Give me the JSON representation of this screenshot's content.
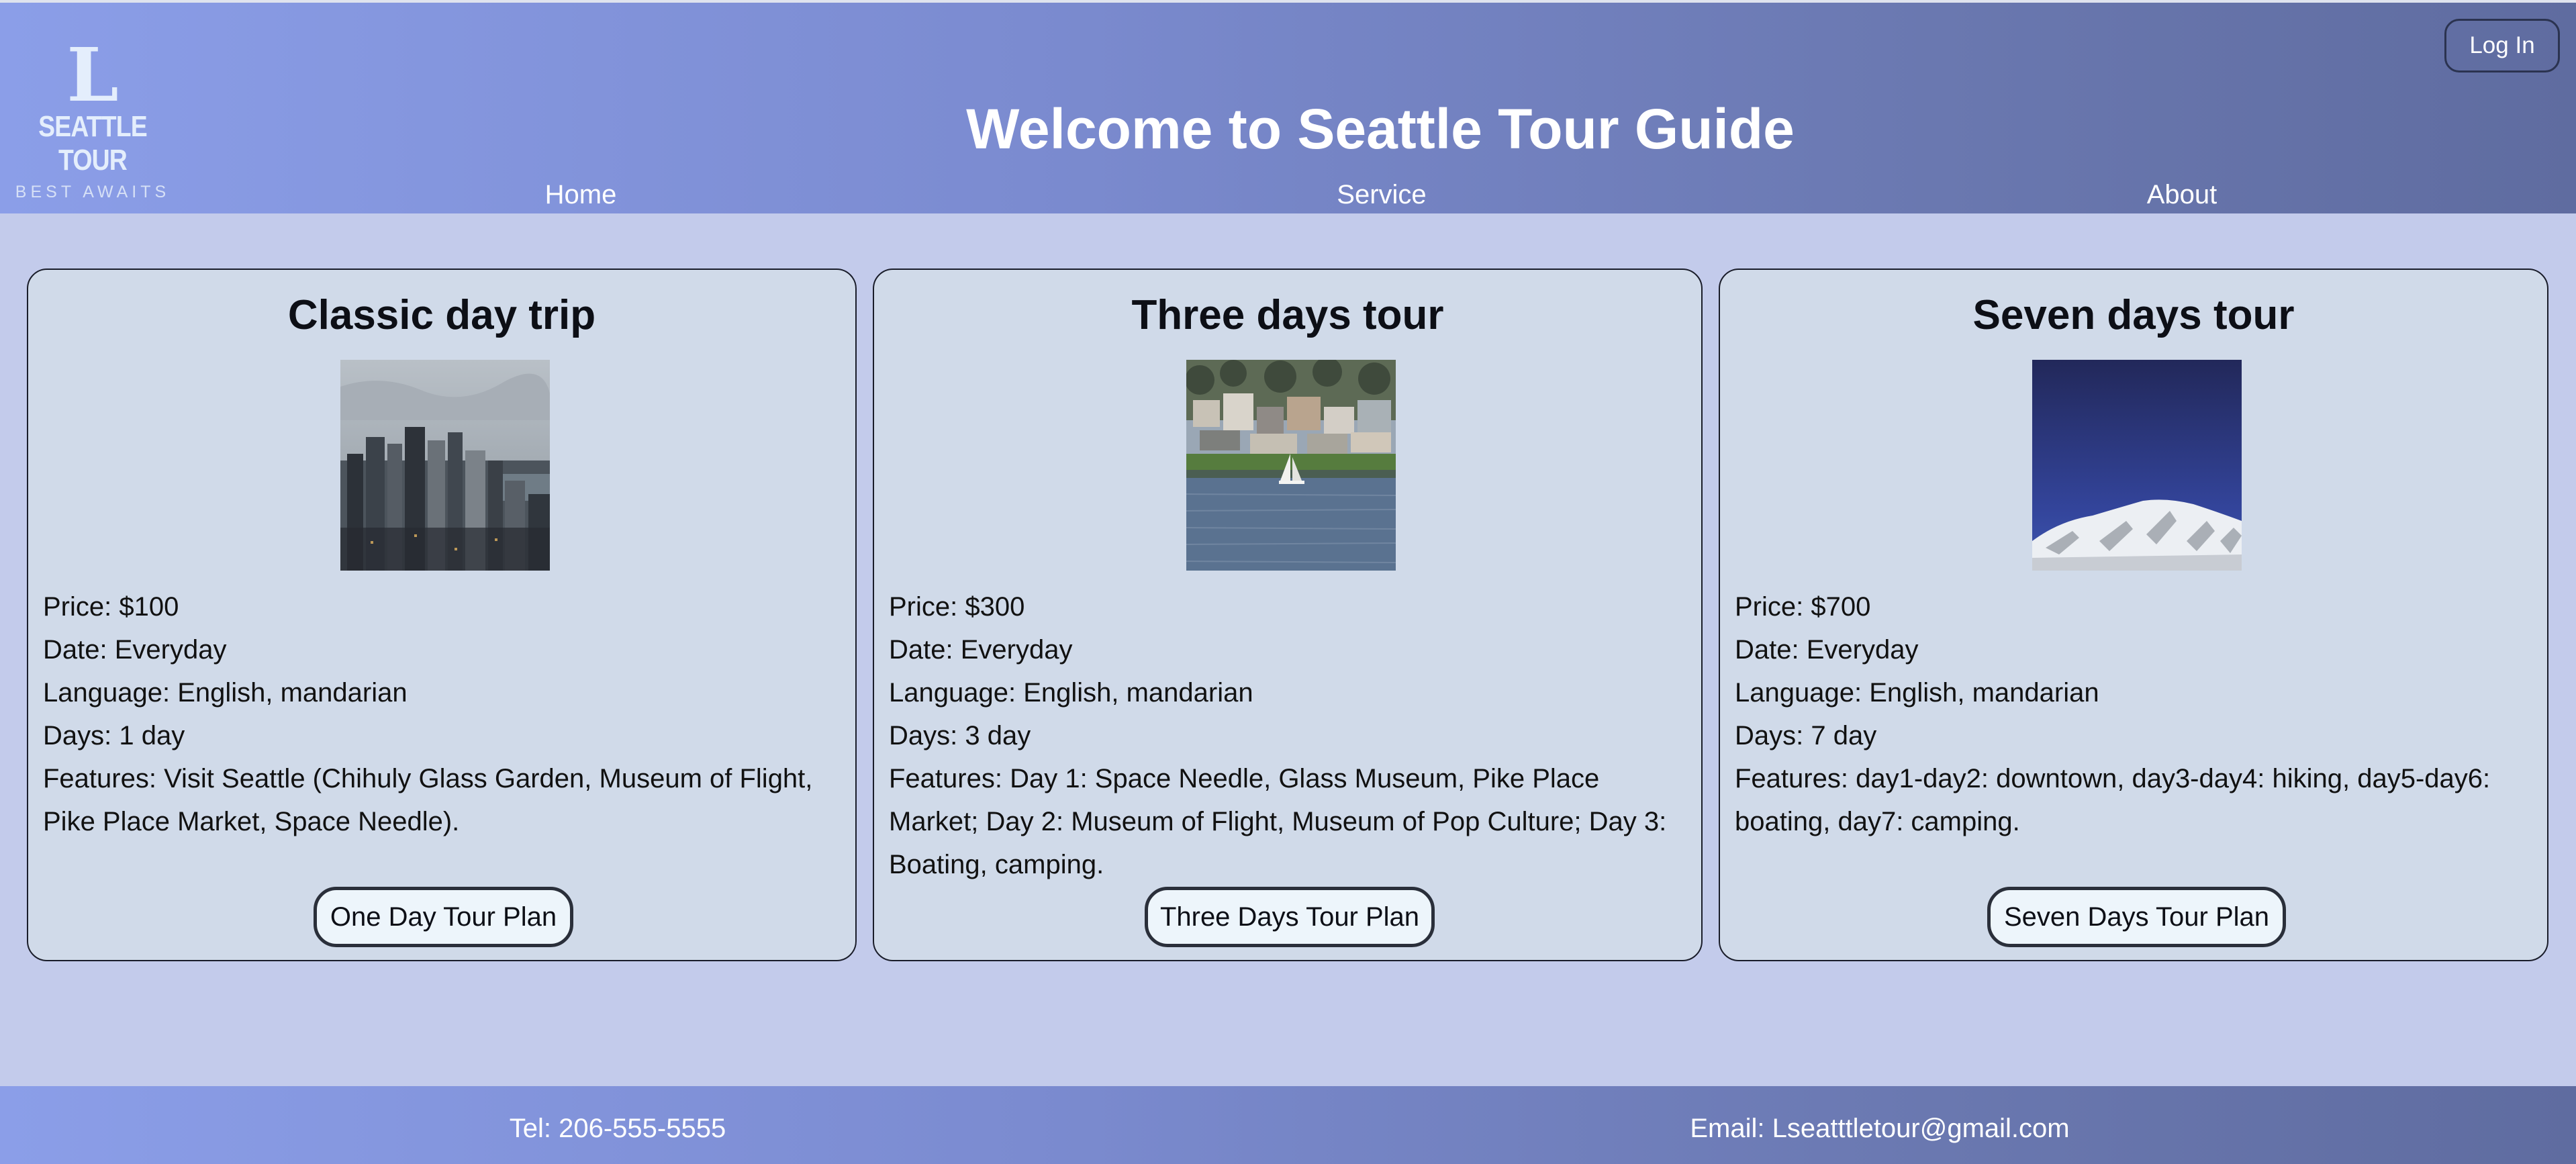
{
  "header": {
    "logo": {
      "letter": "L",
      "name": "SEATTLE TOUR",
      "tagline": "BEST AWAITS"
    },
    "login_label": "Log In",
    "title": "Welcome to Seattle Tour Guide",
    "nav": [
      {
        "label": "Home"
      },
      {
        "label": "Service"
      },
      {
        "label": "About"
      }
    ]
  },
  "tours": [
    {
      "title": "Classic day trip",
      "image": "seattle-skyline-photo",
      "price": "Price: $100",
      "date": "Date: Everyday",
      "language": "Language: English, mandarian",
      "days": "Days: 1 day",
      "features": "Features: Visit Seattle (Chihuly Glass Garden, Museum of Flight, Pike Place Market, Space Needle).",
      "button": "One Day Tour Plan"
    },
    {
      "title": "Three days tour",
      "image": "waterfront-sailboat-photo",
      "price": "Price: $300",
      "date": "Date: Everyday",
      "language": "Language: English, mandarian",
      "days": "Days: 3 day",
      "features": "Features: Day 1: Space Needle, Glass Museum, Pike Place Market; Day 2: Museum of Flight, Museum of Pop Culture; Day 3: Boating, camping.",
      "button": "Three Days Tour Plan"
    },
    {
      "title": "Seven days tour",
      "image": "snowy-mountain-photo",
      "price": "Price: $700",
      "date": "Date: Everyday",
      "language": "Language: English, mandarian",
      "days": "Days: 7 day",
      "features": "Features: day1-day2: downtown, day3-day4: hiking, day5-day6: boating, day7: camping.",
      "button": "Seven Days Tour Plan"
    }
  ],
  "footer": {
    "tel": "Tel: 206-555-5555",
    "email": "Email: Lseatttletour@gmail.com"
  },
  "colors": {
    "header_gradient_start": "#8b9ee8",
    "header_gradient_end": "#5f6ca0",
    "page_background": "#c3cbeb",
    "card_background": "#d0dae9",
    "button_background": "#edf5fb"
  }
}
